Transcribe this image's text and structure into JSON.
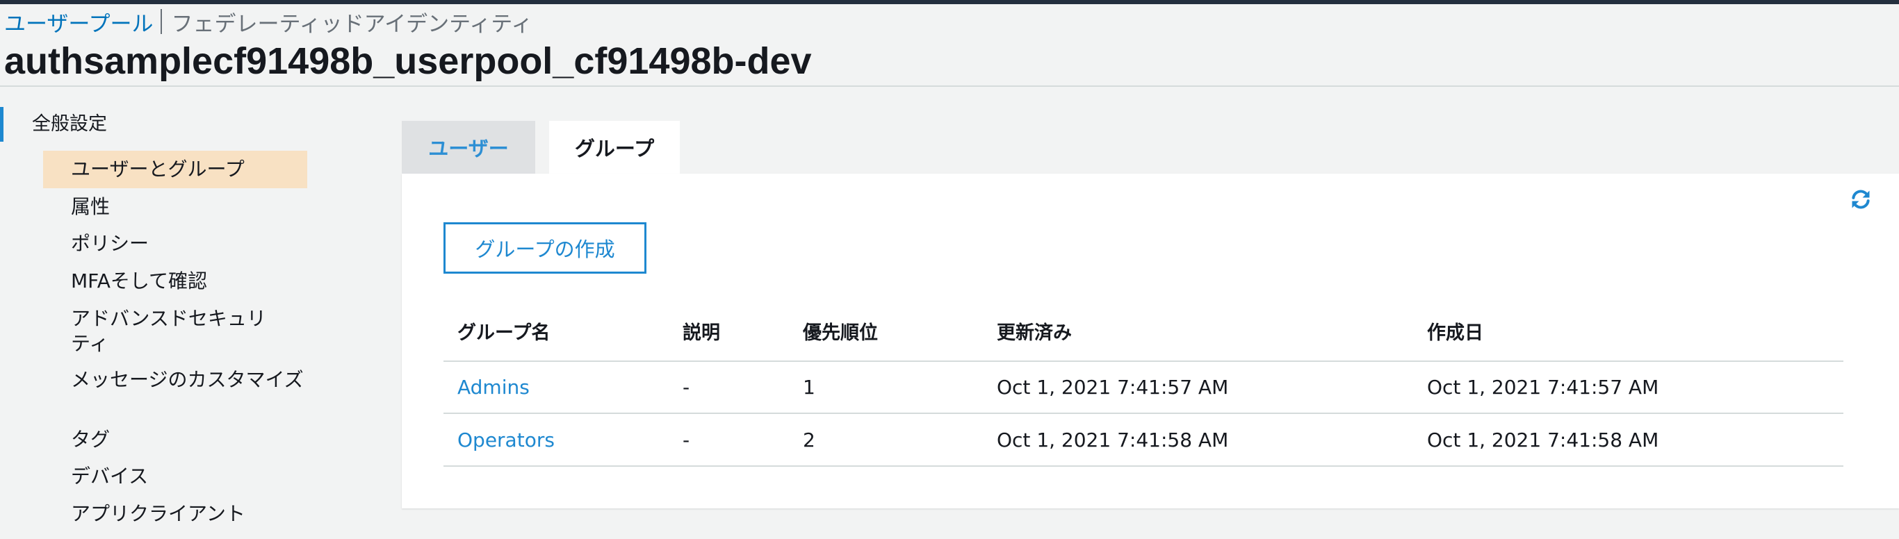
{
  "breadcrumb": {
    "user_pool": "ユーザープール",
    "current": "フェデレーティッドアイデンティティ"
  },
  "page_title": "authsamplecf91498b_userpool_cf91498b-dev",
  "sidebar": {
    "section": "全般設定",
    "items": [
      {
        "label": "ユーザーとグループ",
        "active": true
      },
      {
        "label": "属性"
      },
      {
        "label": "ポリシー"
      },
      {
        "label": "MFAそして確認"
      },
      {
        "label": "アドバンスドセキュリティ"
      },
      {
        "label": "メッセージのカスタマイズ"
      },
      {
        "label": "タグ"
      },
      {
        "label": "デバイス"
      },
      {
        "label": "アプリクライアント"
      }
    ]
  },
  "tabs": [
    {
      "label": "ユーザー"
    },
    {
      "label": "グループ",
      "selected": true
    }
  ],
  "create_group_button": "グループの作成",
  "refresh_icon": "refresh-icon",
  "table": {
    "columns": [
      "グループ名",
      "説明",
      "優先順位",
      "更新済み",
      "作成日"
    ],
    "rows": [
      {
        "name": "Admins",
        "description": "-",
        "precedence": "1",
        "updated": "Oct 1, 2021 7:41:57 AM",
        "created": "Oct 1, 2021 7:41:57 AM"
      },
      {
        "name": "Operators",
        "description": "-",
        "precedence": "2",
        "updated": "Oct 1, 2021 7:41:58 AM",
        "created": "Oct 1, 2021 7:41:58 AM"
      }
    ]
  },
  "colors": {
    "link": "#1e88d0",
    "active_nav": "#f8e1c3",
    "accent": "#1e88d0"
  }
}
